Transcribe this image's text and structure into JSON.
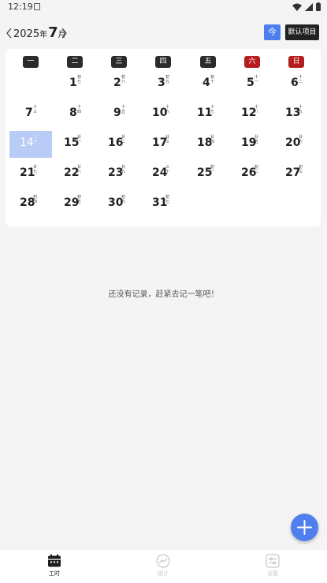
{
  "status_bar": {
    "time": "12:19"
  },
  "header": {
    "year": "2025",
    "year_suffix": "年",
    "month": "7",
    "month_suffix": "月",
    "today_label": "今",
    "project_label": "默认项目"
  },
  "weekdays": [
    "一",
    "二",
    "三",
    "四",
    "五",
    "六",
    "日"
  ],
  "days": [
    {
      "d": "1",
      "lunar": "初七"
    },
    {
      "d": "2",
      "lunar": "初八"
    },
    {
      "d": "3",
      "lunar": "初九"
    },
    {
      "d": "4",
      "lunar": "初十"
    },
    {
      "d": "5",
      "lunar": "十一"
    },
    {
      "d": "6",
      "lunar": "十二"
    },
    {
      "d": "7",
      "lunar": "十三"
    },
    {
      "d": "8",
      "lunar": "十四"
    },
    {
      "d": "9",
      "lunar": "十五"
    },
    {
      "d": "10",
      "lunar": "十六"
    },
    {
      "d": "11",
      "lunar": "十七"
    },
    {
      "d": "12",
      "lunar": "十八"
    },
    {
      "d": "13",
      "lunar": "十九"
    },
    {
      "d": "14",
      "lunar": "二十"
    },
    {
      "d": "15",
      "lunar": "廿一"
    },
    {
      "d": "16",
      "lunar": "廿二"
    },
    {
      "d": "17",
      "lunar": "廿三"
    },
    {
      "d": "18",
      "lunar": "廿四"
    },
    {
      "d": "19",
      "lunar": "廿五"
    },
    {
      "d": "20",
      "lunar": "廿六"
    },
    {
      "d": "21",
      "lunar": "廿七"
    },
    {
      "d": "22",
      "lunar": "廿八"
    },
    {
      "d": "23",
      "lunar": "廿九"
    },
    {
      "d": "24",
      "lunar": "三十"
    },
    {
      "d": "25",
      "lunar": "初一"
    },
    {
      "d": "26",
      "lunar": "初二"
    },
    {
      "d": "27",
      "lunar": "初三"
    },
    {
      "d": "28",
      "lunar": "初四"
    },
    {
      "d": "29",
      "lunar": "初五"
    },
    {
      "d": "30",
      "lunar": "初六"
    },
    {
      "d": "31",
      "lunar": "初七"
    }
  ],
  "selected_day": "14",
  "empty_message": "还没有记录，赶紧去记一笔吧！",
  "nav": [
    {
      "label": "工时",
      "icon": "calendar-icon"
    },
    {
      "label": "统计",
      "icon": "chart-icon"
    },
    {
      "label": "设置",
      "icon": "settings-icon"
    }
  ],
  "colors": {
    "accent": "#4d7ef0",
    "weekend": "#b51e1e",
    "selected": "#b9ccf6"
  }
}
